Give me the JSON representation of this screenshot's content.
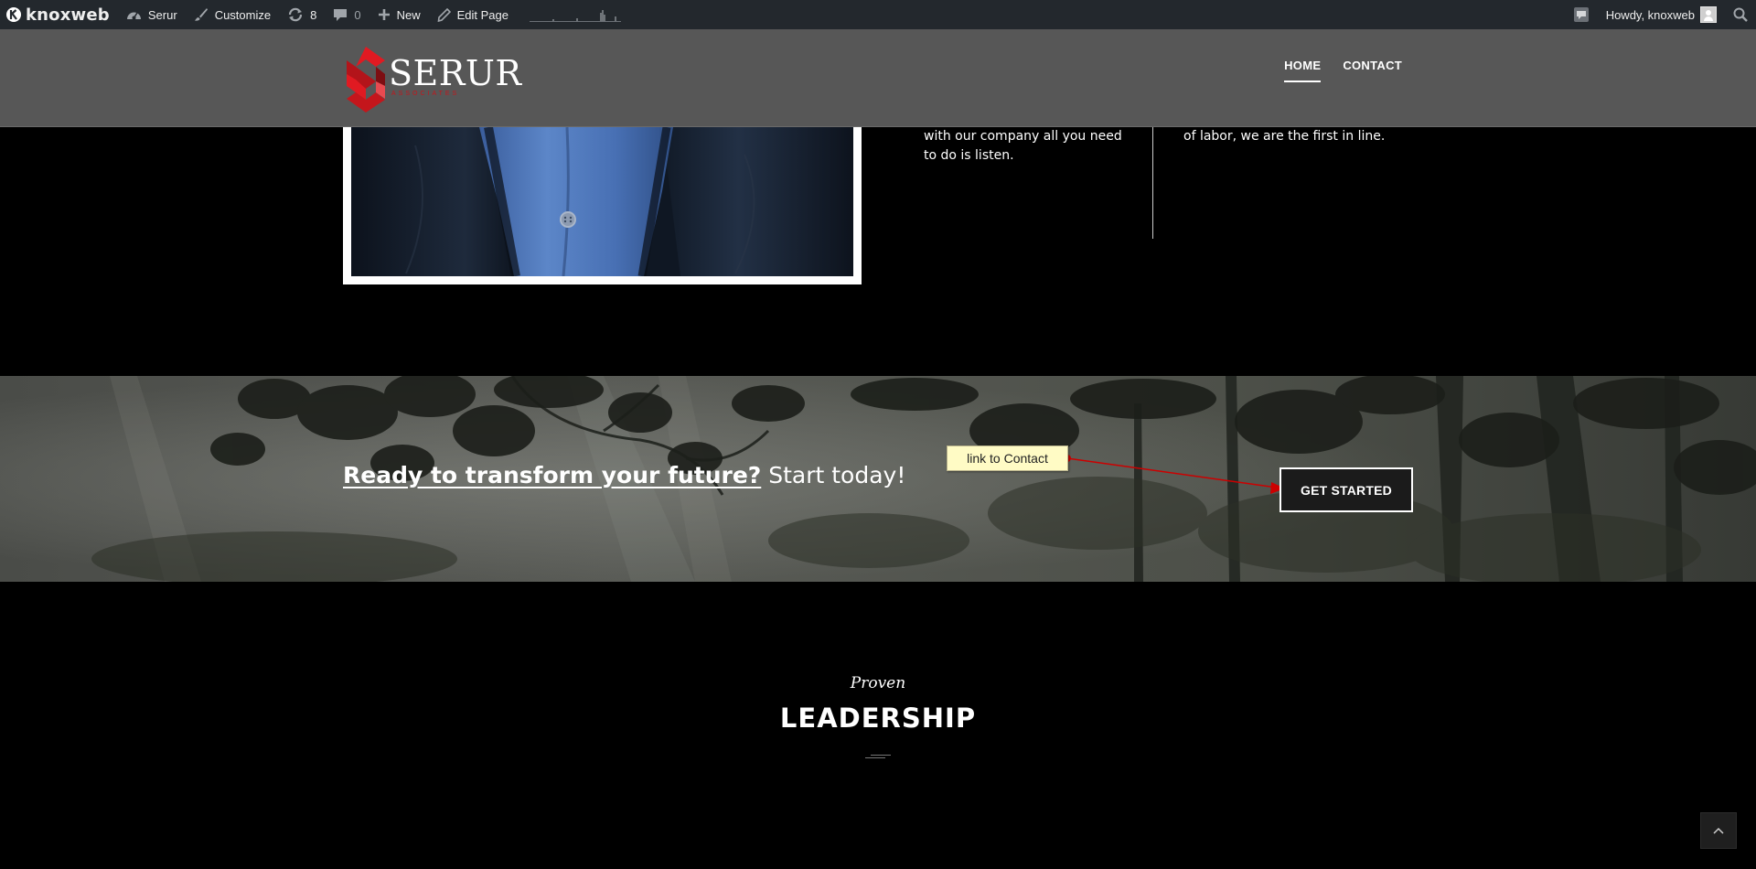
{
  "adminbar": {
    "brand": "knoxweb",
    "site_name": "Serur",
    "customize": "Customize",
    "updates_count": "8",
    "comments_count": "0",
    "new": "New",
    "edit_page": "Edit Page",
    "greeting": "Howdy, knoxweb"
  },
  "header": {
    "logo_text": "SERUR",
    "logo_tagline": "ASSOCIATES",
    "nav": [
      {
        "label": "HOME",
        "active": true
      },
      {
        "label": "CONTACT",
        "active": false
      }
    ]
  },
  "about": {
    "col1_text": "with our company all you need to do is listen.",
    "col2_text": "of labor, we are the first in line."
  },
  "cta": {
    "headline_strong": "Ready to transform your future?",
    "headline_rest": " Start today!",
    "button_label": "GET STARTED",
    "note_label": "link to Contact"
  },
  "leadership": {
    "kicker": "Proven",
    "title": "LEADERSHIP"
  },
  "colors": {
    "admin_bar": "#23282d",
    "header_bg": "#575757",
    "brand_red": "#c4161c",
    "note_yellow": "#fffbc5",
    "arrow_red": "#cc0000"
  }
}
